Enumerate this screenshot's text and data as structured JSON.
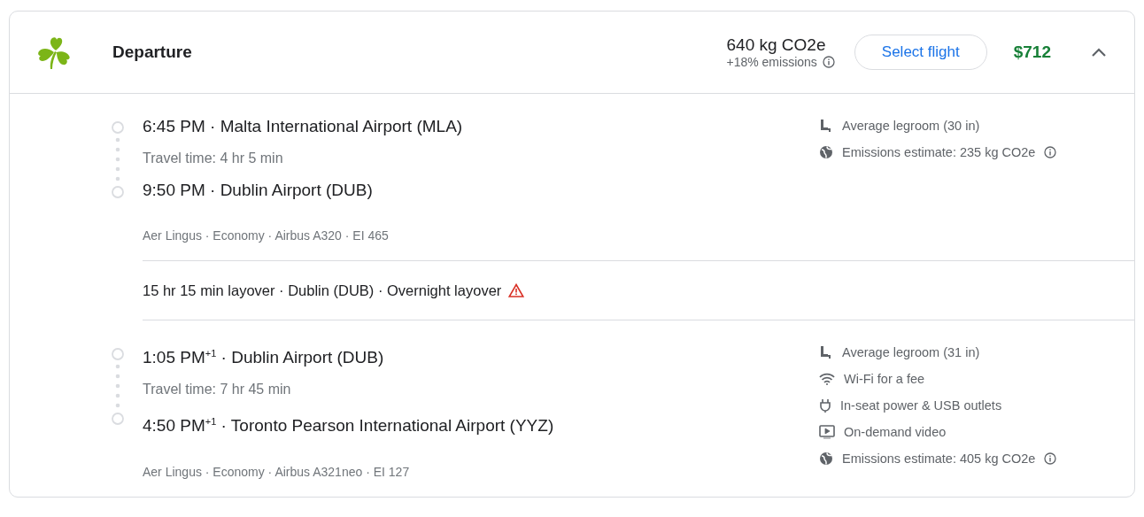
{
  "header": {
    "title": "Departure",
    "emissions": "640 kg CO2e",
    "emissions_delta": "+18% emissions",
    "select_button": "Select flight",
    "price": "$712",
    "expanded": true
  },
  "segments": [
    {
      "kind": "leg",
      "departure": "6:45 PM · Malta International Airport (MLA)",
      "travel_time": "Travel time: 4 hr 5 min",
      "arrival": "9:50 PM · Dublin Airport (DUB)",
      "details": "Aer Lingus · Economy · Airbus A320 · EI 465",
      "amenities": [
        {
          "kind": "legroom",
          "text": "Average legroom (30 in)",
          "info": false
        },
        {
          "kind": "emissions",
          "text": "Emissions estimate: 235 kg CO2e",
          "info": true
        }
      ]
    },
    {
      "kind": "layover",
      "text": "15 hr 15 min layover · Dublin (DUB) · Overnight layover",
      "warning": true
    },
    {
      "kind": "leg",
      "departure": "1:05 PM$^{+1}$ · Dublin Airport (DUB)",
      "travel_time": "Travel time: 7 hr 45 min",
      "arrival": "4:50 PM$^{+1}$ · Toronto Pearson International Airport (YYZ)",
      "details": "Aer Lingus · Economy · Airbus A321neo · EI 127",
      "amenities": [
        {
          "kind": "legroom",
          "text": "Average legroom (31 in)",
          "info": false
        },
        {
          "kind": "wifi",
          "text": "Wi-Fi for a fee",
          "info": false
        },
        {
          "kind": "power",
          "text": "In-seat power & USB outlets",
          "info": false
        },
        {
          "kind": "video",
          "text": "On-demand video",
          "info": false
        },
        {
          "kind": "emissions",
          "text": "Emissions estimate: 405 kg CO2e",
          "info": true
        }
      ]
    }
  ]
}
